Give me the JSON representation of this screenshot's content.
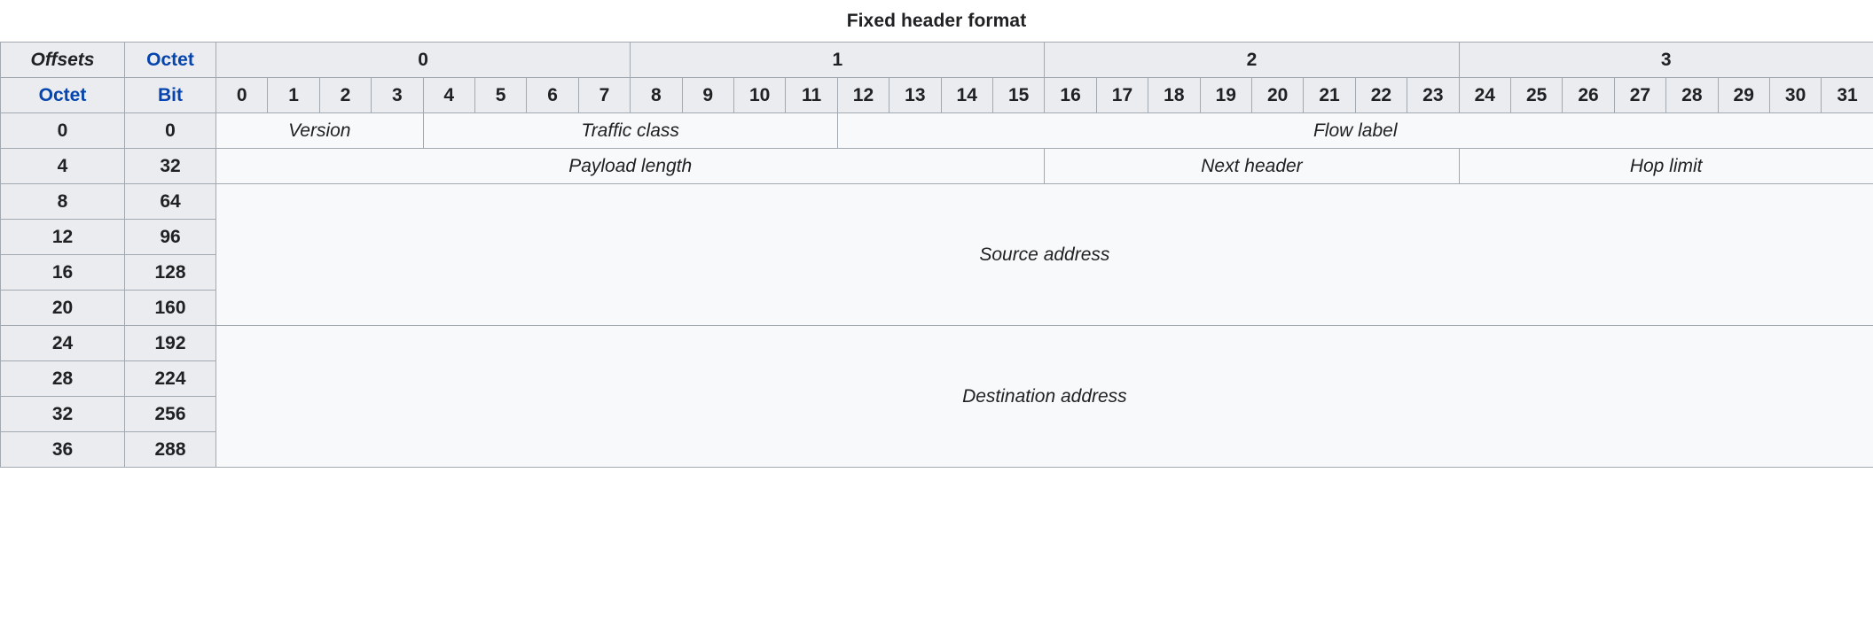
{
  "caption": "Fixed header format",
  "colors": {
    "header_bg": "#eaecf0",
    "cell_bg": "#f8f9fa",
    "border": "#a2a9b1",
    "link": "#0645ad",
    "text": "#202122"
  },
  "header": {
    "offsets_label": "Offsets",
    "octet_link": "Octet",
    "octet_row_label": "Octet",
    "bit_link": "Bit",
    "octet_groups": [
      "0",
      "1",
      "2",
      "3"
    ],
    "bit_numbers": [
      "0",
      "1",
      "2",
      "3",
      "4",
      "5",
      "6",
      "7",
      "8",
      "9",
      "10",
      "11",
      "12",
      "13",
      "14",
      "15",
      "16",
      "17",
      "18",
      "19",
      "20",
      "21",
      "22",
      "23",
      "24",
      "25",
      "26",
      "27",
      "28",
      "29",
      "30",
      "31"
    ]
  },
  "rows": [
    {
      "octet": "0",
      "bit": "0"
    },
    {
      "octet": "4",
      "bit": "32"
    },
    {
      "octet": "8",
      "bit": "64"
    },
    {
      "octet": "12",
      "bit": "96"
    },
    {
      "octet": "16",
      "bit": "128"
    },
    {
      "octet": "20",
      "bit": "160"
    },
    {
      "octet": "24",
      "bit": "192"
    },
    {
      "octet": "28",
      "bit": "224"
    },
    {
      "octet": "32",
      "bit": "256"
    },
    {
      "octet": "36",
      "bit": "288"
    }
  ],
  "fields": {
    "version": "Version",
    "traffic_class": "Traffic class",
    "flow_label": "Flow label",
    "payload_length": "Payload length",
    "next_header": "Next header",
    "hop_limit": "Hop limit",
    "source_address": "Source address",
    "destination_address": "Destination address"
  }
}
